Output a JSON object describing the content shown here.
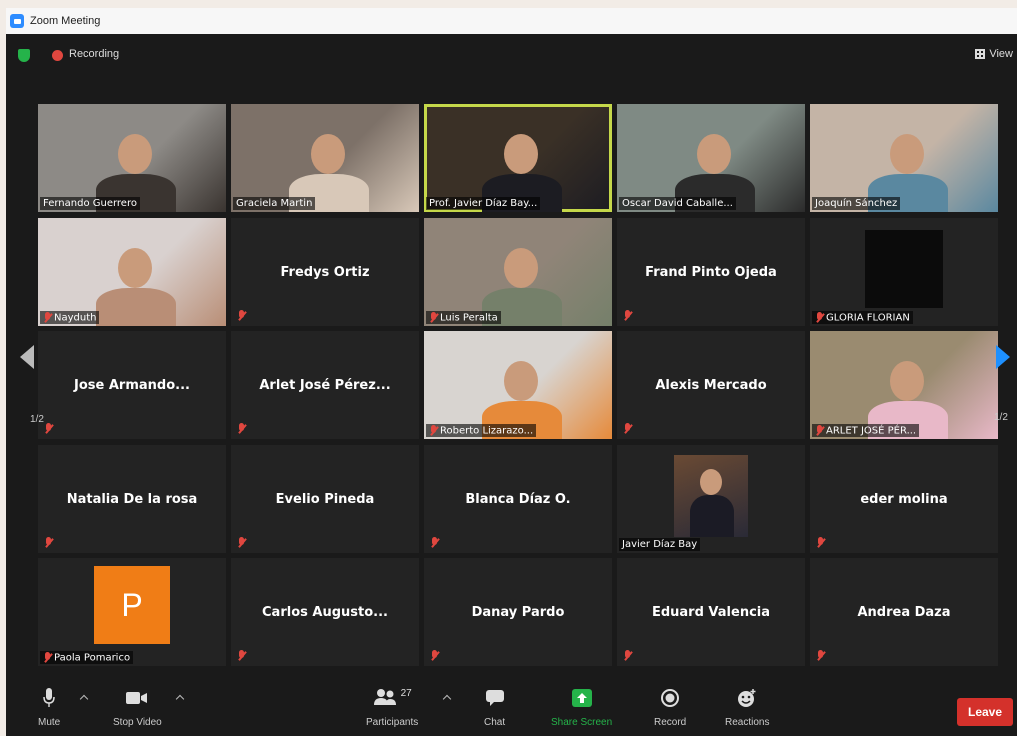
{
  "window": {
    "title": "Zoom Meeting"
  },
  "topbar": {
    "recording_label": "Recording",
    "view_label": "View"
  },
  "pager": {
    "left": "1/2",
    "right": "1/2"
  },
  "participants": [
    {
      "name": "Fernando Guerrero",
      "video": true
    },
    {
      "name": "Graciela Martin",
      "video": true
    },
    {
      "name": "Prof. Javier Díaz Bay...",
      "video": true,
      "active": true
    },
    {
      "name": "Oscar David Caballe...",
      "video": true
    },
    {
      "name": "Joaquín Sánchez",
      "video": true
    },
    {
      "name": "Nayduth",
      "video": true,
      "muted": true
    },
    {
      "name": "Fredys Ortiz",
      "muted": true
    },
    {
      "name": "Luis Peralta",
      "video": true,
      "muted": true
    },
    {
      "name": "Frand Pinto Ojeda",
      "muted": true
    },
    {
      "name": "GLORIA FLORIAN",
      "muted": true,
      "black": true
    },
    {
      "name": "Jose Armando...",
      "muted": true
    },
    {
      "name": "Arlet José Pérez...",
      "muted": true
    },
    {
      "name": "Roberto Lizarazo...",
      "video": true,
      "muted": true
    },
    {
      "name": "Alexis Mercado",
      "muted": true
    },
    {
      "name": "ARLET JOSÉ PÉR...",
      "video": true,
      "muted": true
    },
    {
      "name": "Natalia De la rosa",
      "muted": true
    },
    {
      "name": "Evelio Pineda",
      "muted": true
    },
    {
      "name": "Blanca Díaz O.",
      "muted": true
    },
    {
      "name": "Javier Díaz Bay",
      "photo": true
    },
    {
      "name": "eder molina",
      "muted": true
    },
    {
      "name": "Paola Pomarico",
      "muted": true,
      "avatar_letter": "P"
    },
    {
      "name": "Carlos Augusto...",
      "muted": true
    },
    {
      "name": "Danay Pardo",
      "muted": true
    },
    {
      "name": "Eduard Valencia",
      "muted": true
    },
    {
      "name": "Andrea Daza",
      "muted": true
    }
  ],
  "toolbar": {
    "mute": "Mute",
    "stop_video": "Stop Video",
    "participants": "Participants",
    "participants_count": "27",
    "chat": "Chat",
    "share_screen": "Share Screen",
    "record": "Record",
    "reactions": "Reactions",
    "leave": "Leave"
  },
  "colors": {
    "accent_active": "#c5d84a",
    "share_green": "#25b34a",
    "leave_red": "#d4312b",
    "avatar_orange": "#f07d16"
  }
}
